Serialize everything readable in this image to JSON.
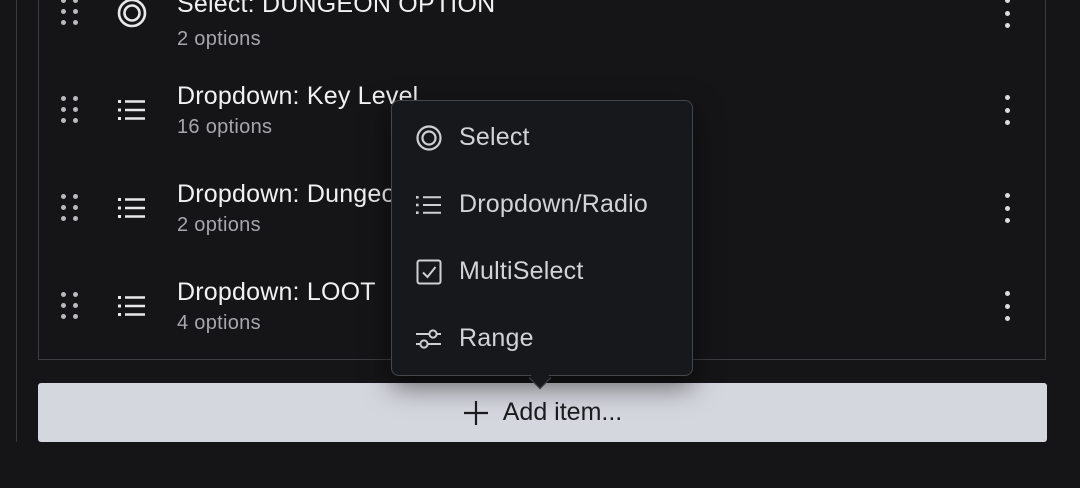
{
  "list": {
    "rows": [
      {
        "title": "Select: DUNGEON OPTION",
        "subtitle": "2 options",
        "icon": "select-circle-icon"
      },
      {
        "title": "Dropdown: Key Level",
        "subtitle": "16 options",
        "icon": "list-icon"
      },
      {
        "title": "Dropdown: Dungeon",
        "subtitle": "2 options",
        "icon": "list-icon"
      },
      {
        "title": "Dropdown: LOOT",
        "subtitle": "4 options",
        "icon": "list-icon"
      }
    ]
  },
  "menu": {
    "items": [
      {
        "label": "Select",
        "icon": "select-circle-icon"
      },
      {
        "label": "Dropdown/Radio",
        "icon": "list-icon"
      },
      {
        "label": "MultiSelect",
        "icon": "checkbox-icon"
      },
      {
        "label": "Range",
        "icon": "sliders-icon"
      }
    ]
  },
  "add_button": {
    "label": "Add item...",
    "icon": "plus-icon"
  },
  "colors": {
    "background": "#151517",
    "panel_border": "#3d3d42",
    "popover_bg": "#17181b",
    "button_bg": "#d4d7de",
    "text_primary": "#f1f1f3",
    "text_secondary": "#a6a6ac"
  }
}
